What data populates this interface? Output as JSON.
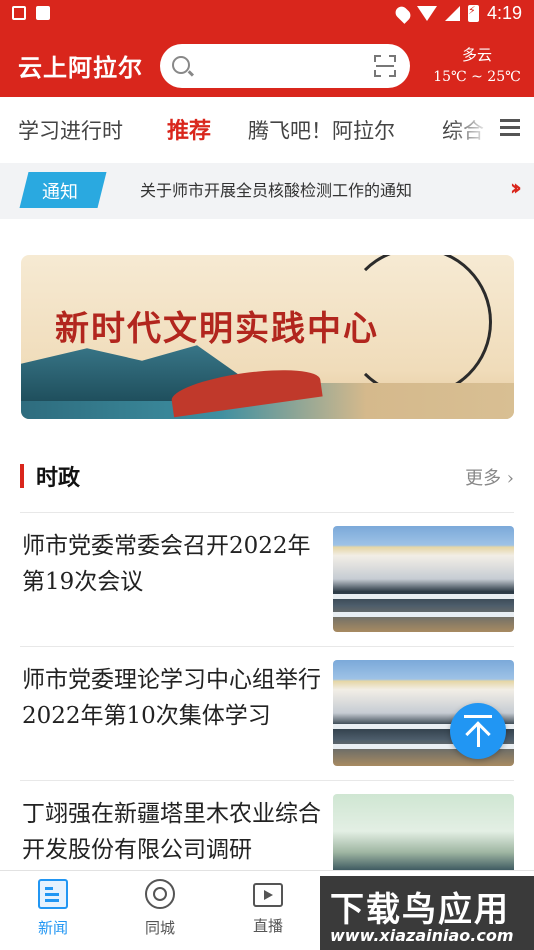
{
  "status_bar": {
    "time": "4:19",
    "icons": [
      "mail-icon",
      "font-icon",
      "location-icon",
      "wifi-icon",
      "signal-icon",
      "battery-charging-icon"
    ]
  },
  "header": {
    "brand": "云上阿拉尔",
    "search": {
      "placeholder": "",
      "search_icon": "search-icon",
      "scan_icon": "scan-icon"
    },
    "weather": {
      "condition": "多云",
      "temperature": "15℃ ~ 25℃"
    },
    "brand_color": "#d9261c"
  },
  "tabs": {
    "items": [
      {
        "label": "学习进行时",
        "active": false
      },
      {
        "label": "推荐",
        "active": true
      },
      {
        "label": "腾飞吧！阿拉尔",
        "active": false
      },
      {
        "label": "综合",
        "active": false
      }
    ],
    "menu_icon": "hamburger-menu-icon"
  },
  "notice": {
    "badge": "通知",
    "text": "关于师市开展全员核酸检测工作的通知",
    "badge_color": "#2aa9e0"
  },
  "banner": {
    "title": "新时代文明实践中心"
  },
  "section": {
    "title": "时政",
    "more": "更多 ›"
  },
  "news": [
    {
      "title": "师市党委常委会召开2022年第19次会议",
      "thumb": "meeting-photo"
    },
    {
      "title": "师市党委理论学习中心组举行2022年第10次集体学习",
      "thumb": "meeting-photo"
    },
    {
      "title": "丁翊强在新疆塔里木农业综合开发股份有限公司调研",
      "thumb": "site-visit-photo"
    }
  ],
  "bottom_nav": {
    "items": [
      {
        "label": "新闻",
        "icon": "news-icon",
        "active": true
      },
      {
        "label": "同城",
        "icon": "city-icon",
        "active": false
      },
      {
        "label": "直播",
        "icon": "live-tv-icon",
        "active": false
      }
    ],
    "active_color": "#2196f3"
  },
  "watermark": {
    "main": "下载鸟应用",
    "url": "www.xiazainiao.com"
  }
}
